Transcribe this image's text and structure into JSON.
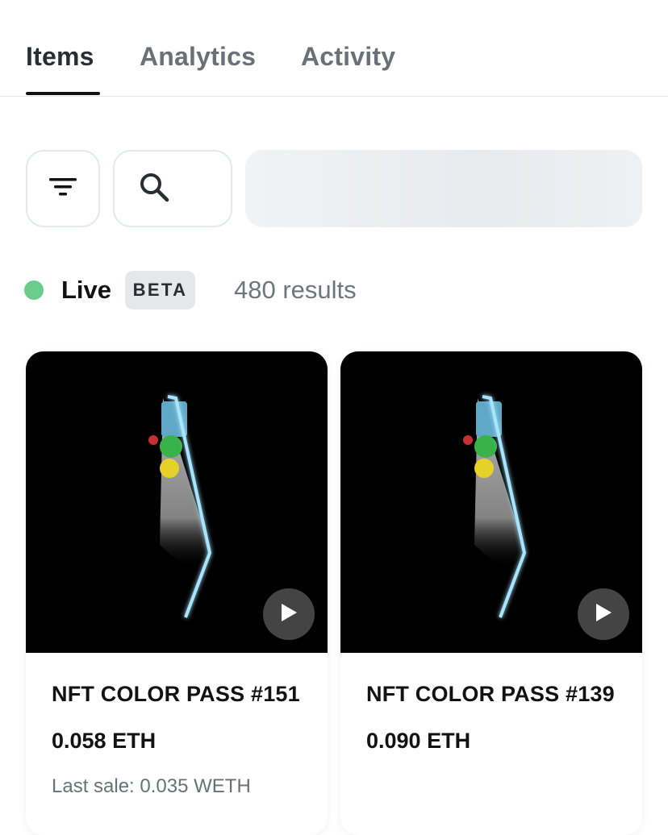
{
  "tabs": [
    {
      "label": "Items",
      "active": true
    },
    {
      "label": "Analytics",
      "active": false
    },
    {
      "label": "Activity",
      "active": false
    }
  ],
  "toolbar": {
    "filter_icon": "filter-icon",
    "search_icon": "search-icon"
  },
  "status": {
    "live_label": "Live",
    "beta_label": "BETA",
    "results_text": "480 results",
    "live_color": "#6bcd8c"
  },
  "items": [
    {
      "title": "NFT COLOR PASS #151",
      "price": "0.058 ETH",
      "last_sale": "Last sale: 0.035 WETH",
      "media_icon": "play-icon"
    },
    {
      "title": "NFT COLOR PASS #139",
      "price": "0.090 ETH",
      "last_sale": "",
      "media_icon": "play-icon"
    }
  ]
}
